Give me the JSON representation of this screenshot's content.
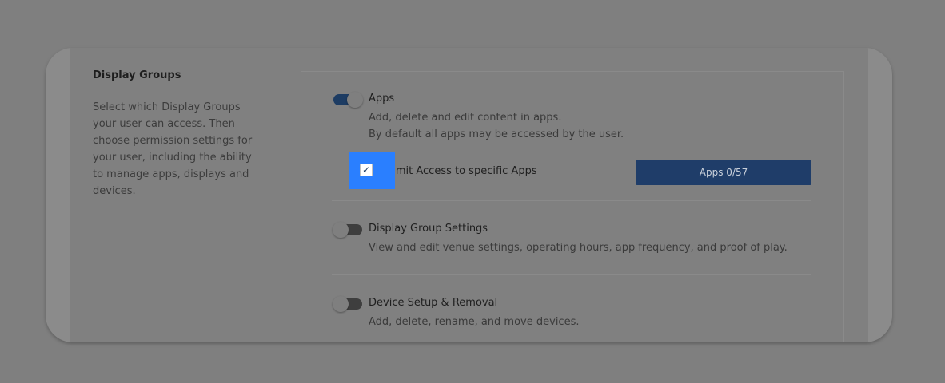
{
  "section": {
    "title": "Display Groups",
    "description": "Select which Display Groups your user can access. Then choose permission settings for your user, including the ability to manage apps, displays and devices."
  },
  "permissions": [
    {
      "title": "Apps",
      "enabled": true,
      "description_lines": [
        "Add, delete and edit content in apps.",
        "By default all apps may be accessed by the user."
      ],
      "limit": {
        "label": "Limit Access to specific Apps",
        "checked": true,
        "check_glyph": "✓",
        "button_label": "Apps  0/57"
      }
    },
    {
      "title": "Display Group Settings",
      "enabled": false,
      "description_lines": [
        "View and edit venue settings, operating hours, app frequency, and proof of play."
      ]
    },
    {
      "title": "Device Setup & Removal",
      "enabled": false,
      "description_lines": [
        "Add, delete, rename, and move devices."
      ]
    }
  ],
  "colors": {
    "overlay": "#7f7f7f",
    "toggle_on": "#1d3c63",
    "button": "#1f3d69",
    "highlight": "#2a7fff"
  }
}
